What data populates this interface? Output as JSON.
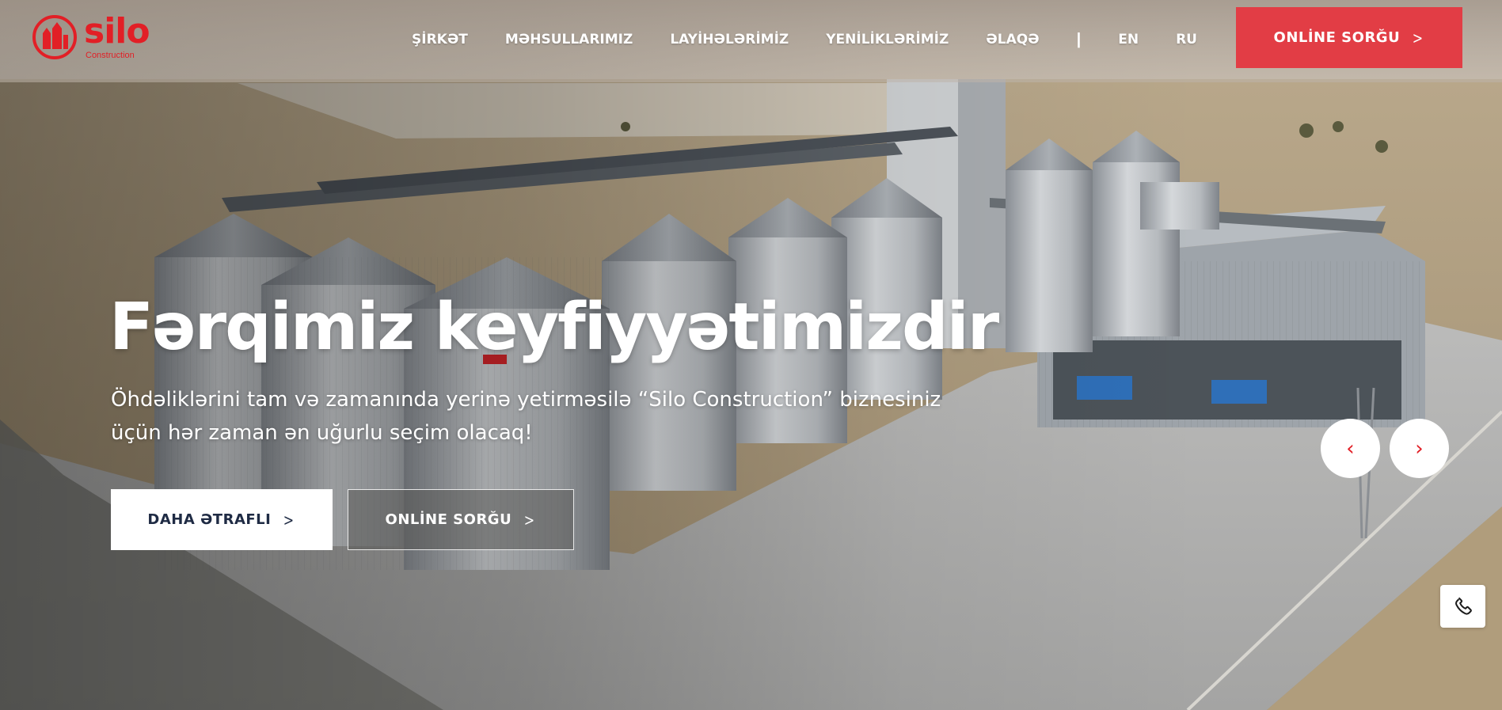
{
  "brand": {
    "name": "silo",
    "subtitle": "Construction",
    "logo_icon": "silo-logo-icon",
    "accent_color": "#e21f26"
  },
  "nav": {
    "items": [
      {
        "label": "ŞİRKƏT"
      },
      {
        "label": "MƏHSULLARIMIZ"
      },
      {
        "label": "LAYİHƏLƏRİMİZ"
      },
      {
        "label": "YENİLİKLƏRİMİZ"
      },
      {
        "label": "ƏLAQƏ"
      }
    ],
    "separator": "|",
    "languages": [
      {
        "label": "EN"
      },
      {
        "label": "RU"
      }
    ],
    "cta_label": "ONLİNE SORĞU"
  },
  "hero": {
    "title": "Fərqimiz keyfiyyətimizdir",
    "subtitle": "Öhdəliklərini tam və zamanında yerinə yetirməsilə “Silo Construction” biznesiniz üçün hər zaman ən uğurlu seçim olacaq!",
    "primary_button": "DAHA ƏTRAFLI",
    "secondary_button": "ONLİNE SORĞU",
    "background_image": "grain silo facility aerial photo"
  },
  "slider": {
    "prev_icon": "‹",
    "next_icon": "›"
  },
  "floating": {
    "phone_icon": "phone-icon"
  }
}
